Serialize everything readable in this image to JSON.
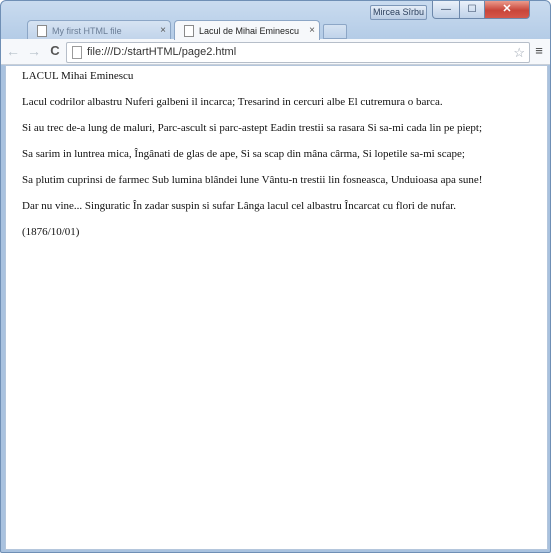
{
  "window": {
    "user_badge": "Mircea Sîrbu",
    "controls": {
      "minimize": "—",
      "maximize": "☐",
      "close": "✕"
    }
  },
  "tabs": [
    {
      "title": "My first HTML file",
      "close": "×",
      "active": false
    },
    {
      "title": "Lacul de Mihai Eminescu",
      "close": "×",
      "active": true
    }
  ],
  "toolbar": {
    "back": "←",
    "forward": "→",
    "reload": "C",
    "url": "file:///D:/startHTML/page2.html",
    "bookmark": "☆",
    "menu": "≡"
  },
  "page": {
    "heading": "LACUL Mihai Eminescu",
    "lines": [
      "Lacul codrilor albastru Nuferi galbeni il incarca; Tresarind in cercuri albe El cutremura o barca.",
      "Si au trec de-a lung de maluri, Parc-ascult si parc-astept Eadin trestii sa rasara Si sa-mi cada lin pe piept;",
      "Sa sarim in luntrea mica, Îngânati de glas de ape, Si sa scap din mâna cârma, Si lopetile sa-mi scape;",
      "Sa plutim cuprinsi de farmec Sub lumina blândei lune Vântu-n trestii lin fosneasca, Unduioasa apa sune!",
      "Dar nu vine... Singuratic În zadar suspin si sufar Lânga lacul cel albastru Încarcat cu flori de nufar."
    ],
    "date": "(1876/10/01)"
  }
}
